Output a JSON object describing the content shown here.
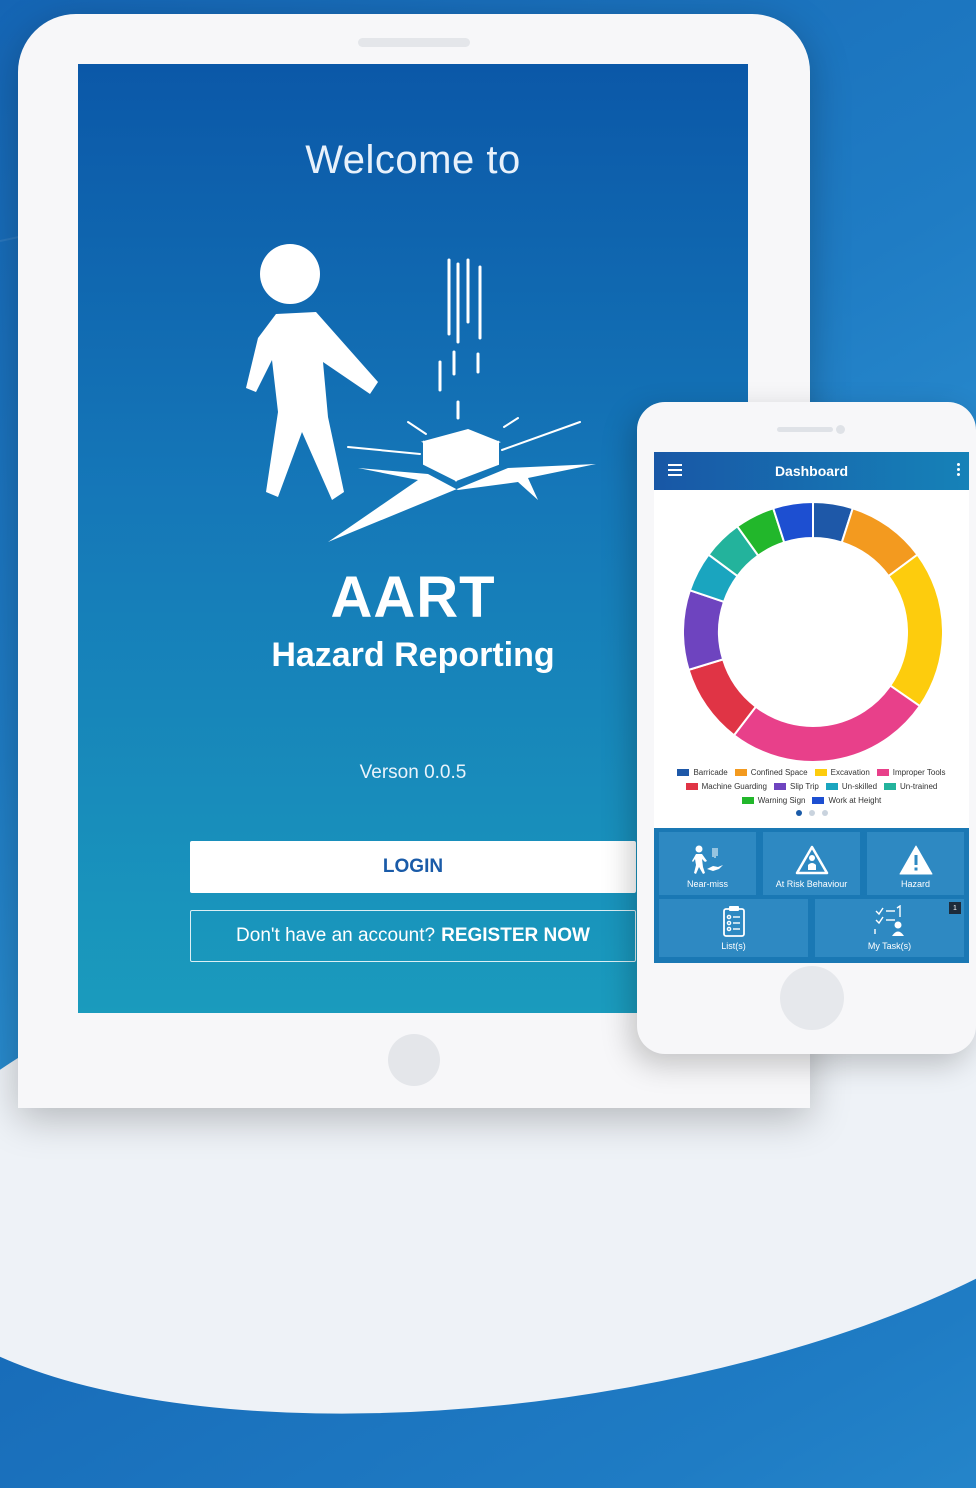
{
  "tablet": {
    "welcome_text": "Welcome to",
    "app_name": "AART",
    "app_subtitle": "Hazard Reporting",
    "version_text": "Verson 0.0.5",
    "login_label": "LOGIN",
    "register_prompt": "Don't have an account?",
    "register_label": "REGISTER NOW"
  },
  "phone": {
    "topbar_title": "Dashboard",
    "legend": [
      {
        "label": "Barricade",
        "color": "#1e58a8"
      },
      {
        "label": "Confined Space",
        "color": "#f39a1f"
      },
      {
        "label": "Excavation",
        "color": "#fdcc0d"
      },
      {
        "label": "Improper Tools",
        "color": "#e8408a"
      },
      {
        "label": "Machine Guarding",
        "color": "#e03445"
      },
      {
        "label": "Slip Trip",
        "color": "#6e44bf"
      },
      {
        "label": "Un-skilled",
        "color": "#1aa5bf"
      },
      {
        "label": "Un-trained",
        "color": "#23b39c"
      },
      {
        "label": "Warning Sign",
        "color": "#22b72b"
      },
      {
        "label": "Work at Height",
        "color": "#1d4fd1"
      }
    ],
    "tiles": {
      "near_miss": "Near-miss",
      "at_risk": "At Risk Behaviour",
      "hazard": "Hazard",
      "lists": "List(s)",
      "my_tasks": "My Task(s)",
      "my_tasks_badge": "1"
    }
  },
  "chart_data": {
    "type": "pie",
    "title": "",
    "categories": [
      "Barricade",
      "Confined Space",
      "Excavation",
      "Improper Tools",
      "Machine Guarding",
      "Slip Trip",
      "Un-skilled",
      "Un-trained",
      "Warning Sign",
      "Work at Height"
    ],
    "values": [
      5,
      10,
      20,
      26,
      10,
      10,
      5,
      5,
      5,
      5
    ],
    "colors": [
      "#1e58a8",
      "#f39a1f",
      "#fdcc0d",
      "#e8408a",
      "#e03445",
      "#6e44bf",
      "#1aa5bf",
      "#23b39c",
      "#22b72b",
      "#1d4fd1"
    ],
    "donut": true,
    "legend_position": "bottom"
  }
}
